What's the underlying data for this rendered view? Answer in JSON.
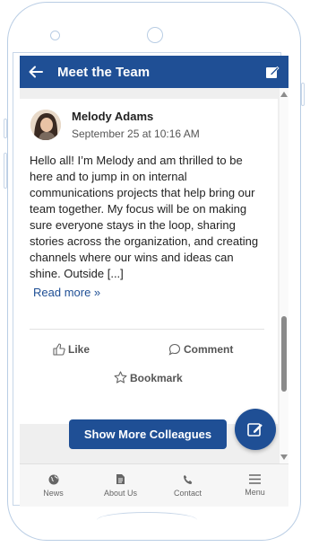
{
  "header": {
    "title": "Meet the Team"
  },
  "post": {
    "author_name": "Melody Adams",
    "date": "September 25 at 10:16 AM",
    "body_lines": [
      "Hello all! I’m Melody and am thrilled to be",
      "here and to jump in on internal",
      "communications projects that help bring our",
      "team together. My focus will be on making",
      "sure everyone stays in the loop, sharing",
      "stories across the organization, and creating",
      "channels where our wins and ideas can",
      "shine. Outside [...]"
    ],
    "read_more": "Read more »",
    "actions": {
      "like": "Like",
      "comment": "Comment",
      "bookmark": "Bookmark"
    }
  },
  "show_more_label": "Show More Colleagues",
  "bottom_nav": [
    {
      "label": "News",
      "icon": "globe-icon"
    },
    {
      "label": "About Us",
      "icon": "document-icon"
    },
    {
      "label": "Contact",
      "icon": "phone-icon"
    },
    {
      "label": "Menu",
      "icon": "hamburger-icon"
    }
  ],
  "colors": {
    "primary": "#1f4f95",
    "background": "#efefef",
    "card": "#ffffff"
  }
}
